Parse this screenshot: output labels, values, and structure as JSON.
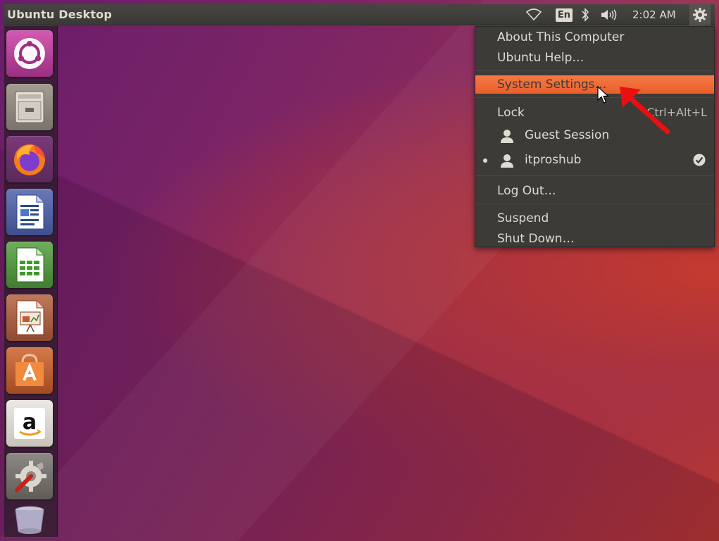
{
  "panel": {
    "title": "Ubuntu Desktop",
    "keyboard_layout": "En",
    "clock": "2:02 AM",
    "icons": [
      "wifi-icon",
      "keyboard-indicator",
      "bluetooth-icon",
      "volume-icon",
      "gear-icon"
    ]
  },
  "launcher": {
    "items": [
      {
        "name": "dash-home",
        "icon": "ubuntu-logo-icon"
      },
      {
        "name": "files",
        "icon": "file-cabinet-icon"
      },
      {
        "name": "firefox",
        "icon": "firefox-icon"
      },
      {
        "name": "libreoffice-writer",
        "icon": "writer-icon"
      },
      {
        "name": "libreoffice-calc",
        "icon": "calc-icon"
      },
      {
        "name": "libreoffice-impress",
        "icon": "impress-icon"
      },
      {
        "name": "software-center",
        "icon": "shopping-bag-icon"
      },
      {
        "name": "amazon",
        "icon": "amazon-icon"
      },
      {
        "name": "system-settings",
        "icon": "settings-wrench-icon"
      },
      {
        "name": "trash",
        "icon": "trash-icon"
      }
    ]
  },
  "menu": {
    "about": "About This Computer",
    "help": "Ubuntu Help…",
    "settings": "System Settings…",
    "lock": "Lock",
    "lock_shortcut": "Ctrl+Alt+L",
    "guest": "Guest Session",
    "user": "itproshub",
    "logout": "Log Out…",
    "suspend": "Suspend",
    "shutdown": "Shut Down…"
  },
  "colors": {
    "highlight": "#e95f2b",
    "panel": "#3c3b37",
    "annotation_arrow": "#e81010"
  }
}
